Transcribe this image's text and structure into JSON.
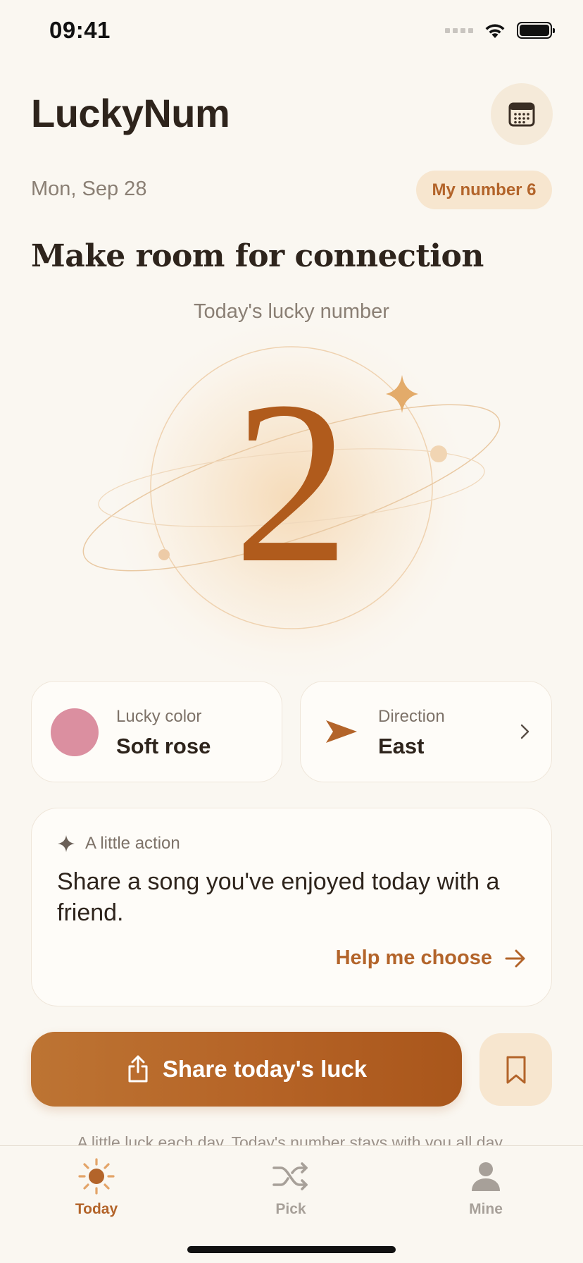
{
  "status_bar": {
    "time": "09:41"
  },
  "header": {
    "app_title": "LuckyNum"
  },
  "date_row": {
    "date": "Mon, Sep 28",
    "my_number_badge": "My number 6"
  },
  "headline": "Make room for connection",
  "lucky": {
    "label": "Today's lucky number",
    "number": "2"
  },
  "lucky_color": {
    "label": "Lucky color",
    "value": "Soft rose",
    "swatch_hex": "#db8fa0"
  },
  "direction": {
    "label": "Direction",
    "value": "East"
  },
  "action": {
    "label": "A little action",
    "text": "Share a song you've enjoyed today with a friend.",
    "link": "Help me choose"
  },
  "share_button": {
    "label": "Share today's luck"
  },
  "footer_note": "A little luck each day. Today's number stays with you all day.",
  "tabs": [
    {
      "label": "Today",
      "icon": "sun-icon",
      "active": true
    },
    {
      "label": "Pick",
      "icon": "shuffle-icon",
      "active": false
    },
    {
      "label": "Mine",
      "icon": "person-icon",
      "active": false
    }
  ],
  "colors": {
    "accent": "#b3642a",
    "background": "#faf7f1",
    "badge_bg": "#f7e6cf"
  }
}
